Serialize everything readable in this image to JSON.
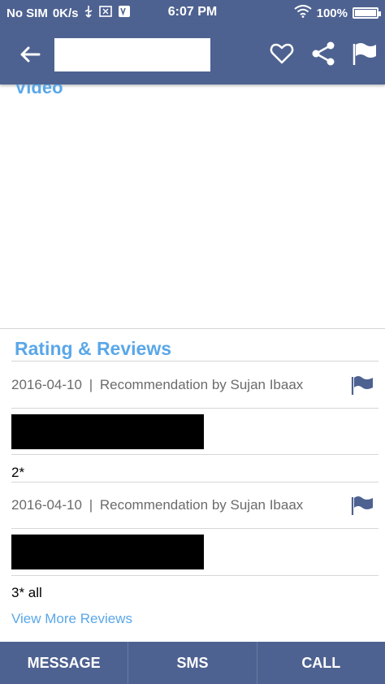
{
  "status_bar": {
    "carrier": "No SIM",
    "speed": "0K/s",
    "time": "6:07 PM",
    "battery": "100%",
    "battery_level": 1.0
  },
  "app_bar": {
    "back_icon": "arrow-left-icon",
    "title": "",
    "actions": [
      "heart-icon",
      "share-icon",
      "flag-icon"
    ]
  },
  "video_section": {
    "label": "Video"
  },
  "reviews": {
    "title": "Rating & Reviews",
    "items": [
      {
        "date": "2016-04-10",
        "separator": "|",
        "author_line": "Recommendation by Sujan Ibaax",
        "rating": "2*"
      },
      {
        "date": "2016-04-10",
        "separator": "|",
        "author_line": "Recommendation by Sujan Ibaax",
        "rating": "3* all"
      }
    ],
    "more_link": "View More Reviews"
  },
  "bottom_bar": {
    "buttons": [
      "MESSAGE",
      "SMS",
      "CALL"
    ]
  },
  "colors": {
    "primary": "#4e6291",
    "accent": "#5aa7e8"
  }
}
